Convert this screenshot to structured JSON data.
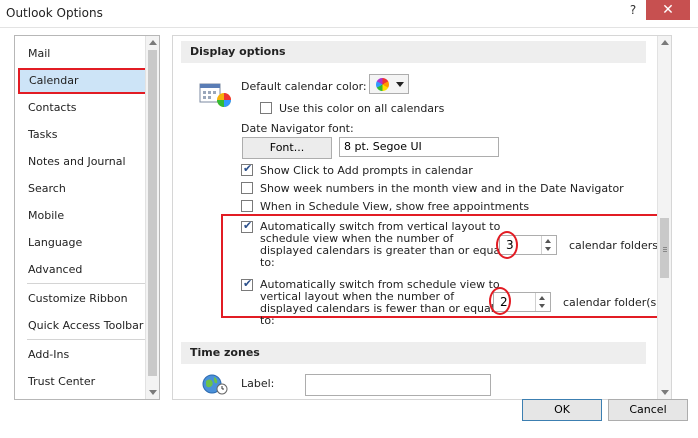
{
  "window": {
    "title": "Outlook Options",
    "help_glyph": "?",
    "close_glyph": "✕"
  },
  "nav": {
    "items": [
      {
        "label": "Mail"
      },
      {
        "label": "Calendar"
      },
      {
        "label": "Contacts"
      },
      {
        "label": "Tasks"
      },
      {
        "label": "Notes and Journal"
      },
      {
        "label": "Search"
      },
      {
        "label": "Mobile"
      },
      {
        "label": "Language"
      },
      {
        "label": "Advanced"
      },
      {
        "label": "Customize Ribbon"
      },
      {
        "label": "Quick Access Toolbar"
      },
      {
        "label": "Add-Ins"
      },
      {
        "label": "Trust Center"
      }
    ],
    "selected": "Calendar"
  },
  "display_options": {
    "header": "Display options",
    "default_color_label": "Default calendar color:",
    "use_color_all": {
      "label": "Use this color on all calendars",
      "checked": false
    },
    "date_nav_font_label": "Date Navigator font:",
    "font_button": "Font...",
    "font_value": "8 pt. Segoe UI",
    "show_click_to_add": {
      "label": "Show Click to Add prompts in calendar",
      "checked": true
    },
    "show_week_numbers": {
      "label": "Show week numbers in the month view and in the Date Navigator",
      "checked": false
    },
    "schedule_view_free": {
      "label": "When in Schedule View, show free appointments",
      "checked": false
    },
    "auto_switch_vertical": {
      "checked": true,
      "lines": [
        "Automatically switch from vertical layout to",
        "schedule view when the number of",
        "displayed calendars is greater than or equal",
        "to:"
      ],
      "value": "3",
      "suffix": "calendar folders"
    },
    "auto_switch_schedule": {
      "checked": true,
      "lines": [
        "Automatically switch from schedule view to",
        "vertical layout when the number of",
        "displayed calendars is fewer than or equal",
        "to:"
      ],
      "value": "2",
      "suffix": "calendar folder(s)"
    }
  },
  "time_zones": {
    "header": "Time zones",
    "label_text": "Label:",
    "label_value": ""
  },
  "footer": {
    "ok": "OK",
    "cancel": "Cancel"
  },
  "colors": {
    "highlight": "#e21c24",
    "selected_bg": "#cde4f7",
    "close_red": "#c75050"
  }
}
